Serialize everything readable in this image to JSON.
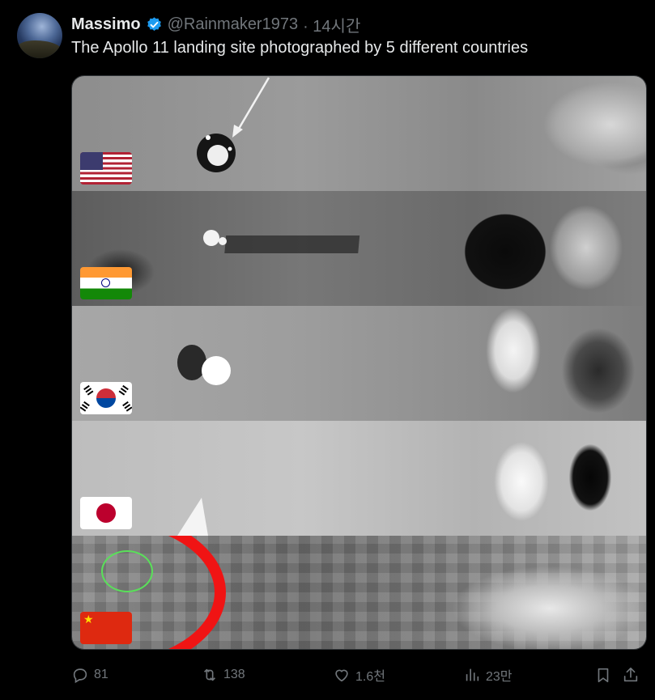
{
  "author": {
    "name": "Massimo",
    "handle": "@Rainmaker1973",
    "time": "· 14시간",
    "verified": true
  },
  "tweet": {
    "text": "The Apollo 11 landing site photographed by 5 different countries"
  },
  "media": {
    "panels": [
      {
        "flag": "united-states-flag"
      },
      {
        "flag": "india-flag"
      },
      {
        "flag": "south-korea-flag"
      },
      {
        "flag": "japan-flag"
      },
      {
        "flag": "china-flag"
      }
    ]
  },
  "actions": {
    "replies": "81",
    "retweets": "138",
    "likes": "1.6천",
    "views": "23만"
  },
  "colors": {
    "background": "#000000",
    "text": "#e7e9ea",
    "muted": "#71767b",
    "verified": "#1d9bf0",
    "highlight_red": "#f01414"
  }
}
